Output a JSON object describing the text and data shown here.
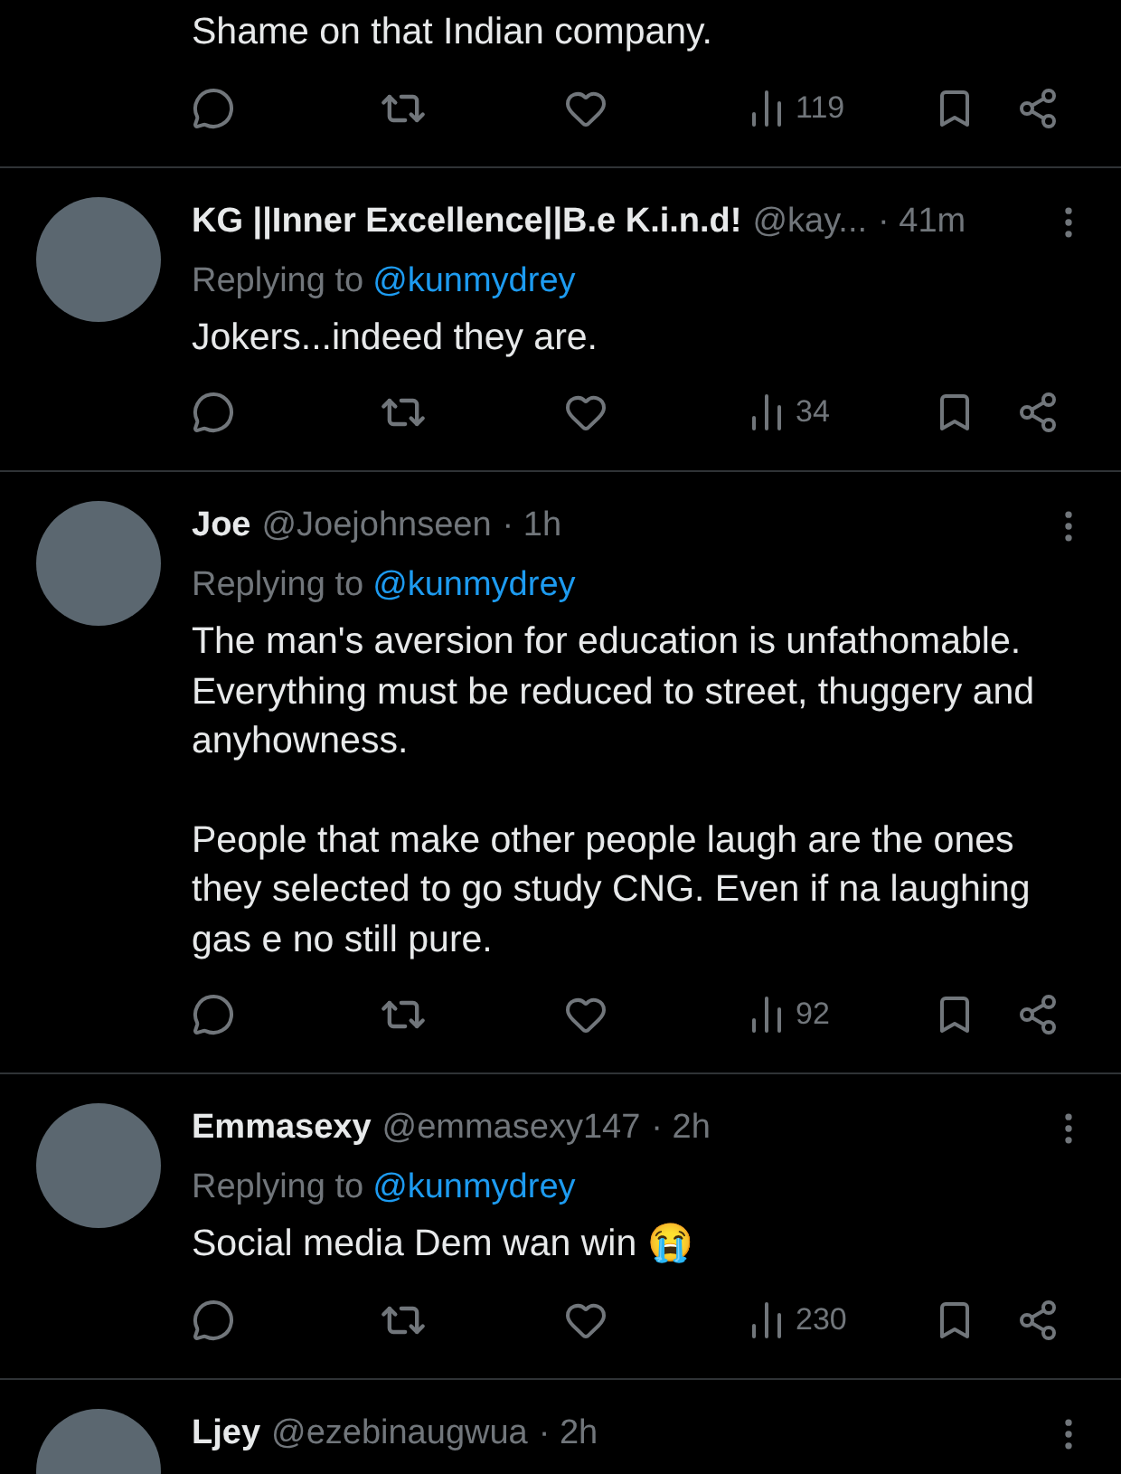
{
  "tweets": [
    {
      "body": [
        "Shame on that Indian company."
      ],
      "views": "119"
    },
    {
      "name": "KG ||Inner Excellence||B.e K.i.n.d!",
      "handle": "@kay...",
      "time": "· 41m",
      "replying_label": "Replying to",
      "replying_to": "@kunmydrey",
      "body": [
        "Jokers...indeed they are."
      ],
      "views": "34"
    },
    {
      "name": "Joe",
      "handle": "@Joejohnseen",
      "time": "· 1h",
      "replying_label": "Replying to",
      "replying_to": "@kunmydrey",
      "body": [
        "The man's aversion for education is unfathomable. Everything must be reduced to street, thuggery and anyhowness.",
        "People that make other people laugh are the ones they selected to go study CNG. Even if na laughing gas e no still pure."
      ],
      "views": "92"
    },
    {
      "name": "Emmasexy",
      "handle": "@emmasexy147",
      "time": "· 2h",
      "replying_label": "Replying to",
      "replying_to": "@kunmydrey",
      "body": [
        "Social media Dem wan win 😭"
      ],
      "views": "230"
    },
    {
      "name": "Ljey",
      "handle": "@ezebinaugwua",
      "time": "· 2h"
    }
  ]
}
